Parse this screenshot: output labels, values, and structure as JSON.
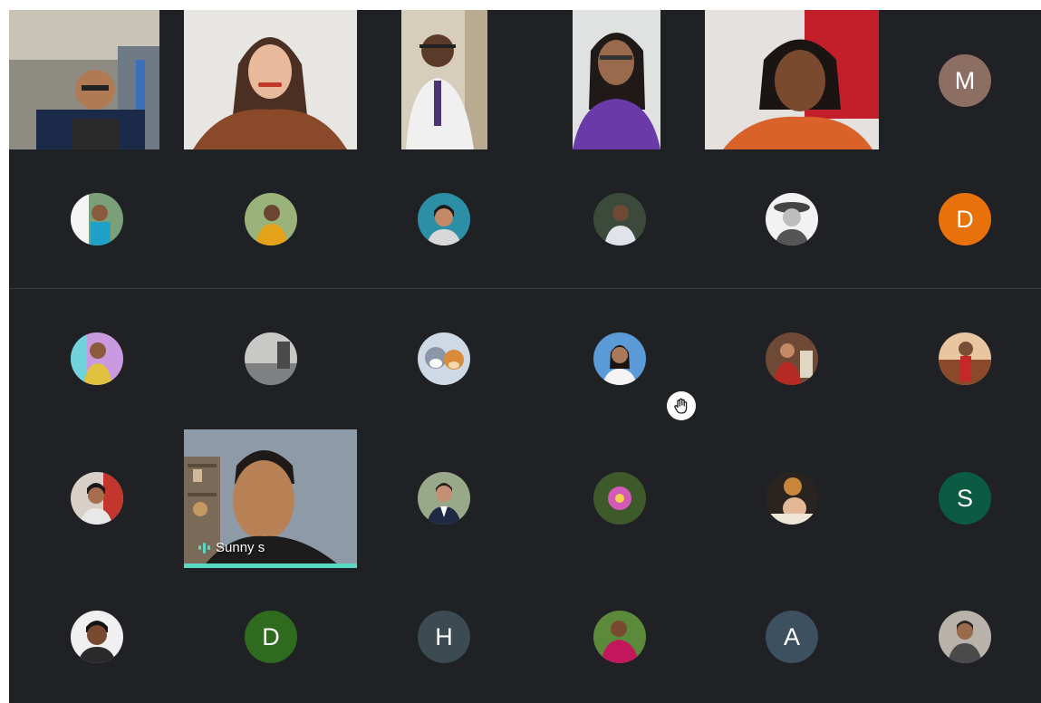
{
  "meeting": {
    "active_speaker": {
      "name": "Sunny s"
    },
    "hand_raised_icon": "hand-raised-icon",
    "colors": {
      "background": "#202124",
      "speaking_accent": "#5bd8c2",
      "avatar_m": "#8d6e63",
      "avatar_d_orange": "#e8710a",
      "avatar_s": "#0b5b43",
      "avatar_d_green": "#2f6b1f",
      "avatar_h": "#3c4a52",
      "avatar_a": "#3d5060"
    },
    "avatars": {
      "m": "M",
      "d1": "D",
      "s": "S",
      "d2": "D",
      "h": "H",
      "a": "A"
    }
  }
}
